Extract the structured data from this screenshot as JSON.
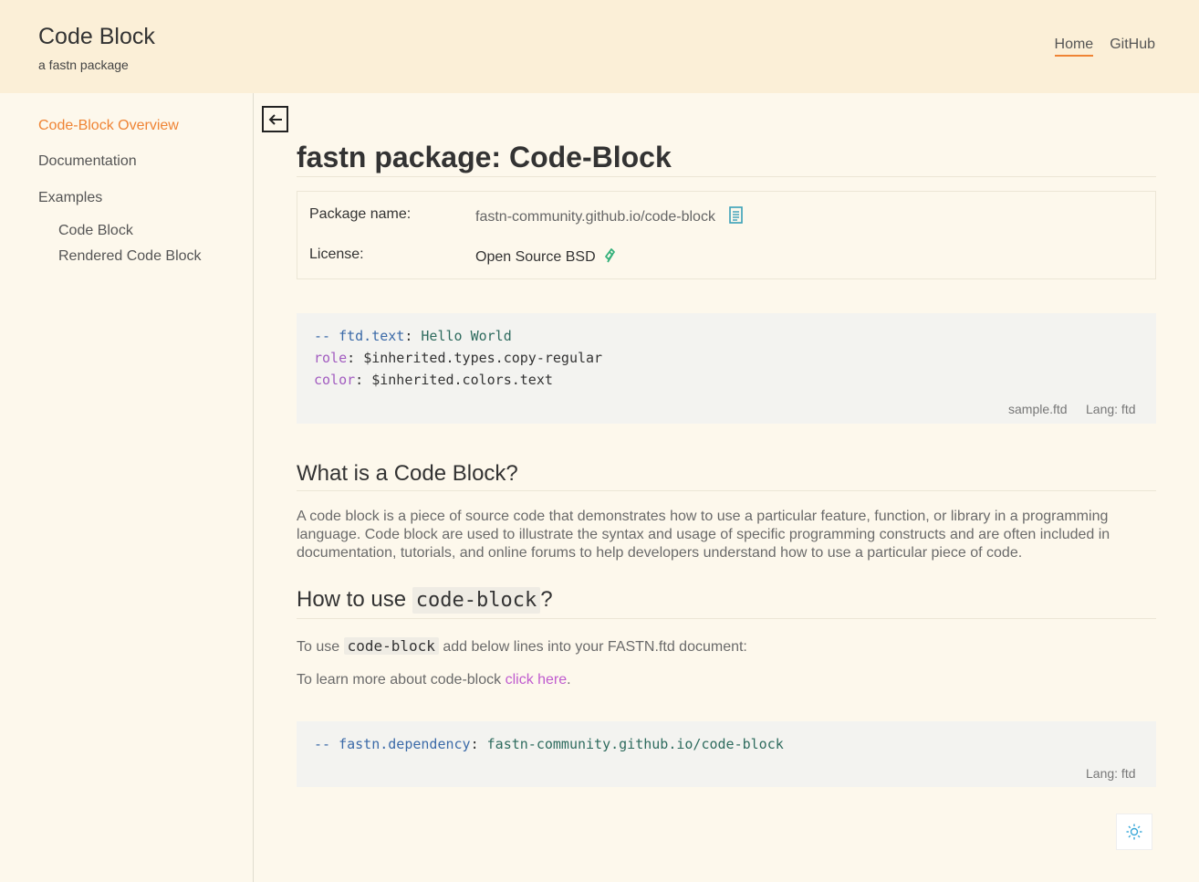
{
  "header": {
    "title": "Code Block",
    "subtitle": "a fastn package",
    "nav": [
      {
        "label": "Home",
        "active": true
      },
      {
        "label": "GitHub",
        "active": false
      }
    ]
  },
  "sidebar": {
    "items": [
      {
        "label": "Code-Block Overview",
        "active": true
      },
      {
        "label": "Documentation"
      },
      {
        "label": "Examples"
      }
    ],
    "subitems": [
      {
        "label": "Code Block"
      },
      {
        "label": "Rendered Code Block"
      }
    ]
  },
  "page": {
    "title": "fastn package: Code-Block",
    "info": {
      "package_label": "Package name:",
      "package_value": "fastn-community.github.io/code-block",
      "license_label": "License:",
      "license_value": "Open Source BSD"
    },
    "code1": {
      "line1_dash": "-- ",
      "line1_key": "ftd.text",
      "line1_colon": ": ",
      "line1_val": "Hello World",
      "line2_key": "role",
      "line2_colon": ": ",
      "line2_val": "$inherited.types.copy-regular",
      "line3_key": "color",
      "line3_colon": ": ",
      "line3_val": "$inherited.colors.text",
      "filename": "sample.ftd",
      "lang": "Lang: ftd"
    },
    "section1": {
      "heading": "What is a Code Block?",
      "text": "A code block is a piece of source code that demonstrates how to use a particular feature, function, or library in a programming language. Code block are used to illustrate the syntax and usage of specific programming constructs and are often included in documentation, tutorials, and online forums to help developers understand how to use a particular piece of code."
    },
    "section2": {
      "heading_pre": "How to use ",
      "heading_code": "code-block",
      "heading_post": "?",
      "usage_pre": "To use ",
      "usage_code": "code-block",
      "usage_post": " add below lines into your FASTN.ftd document:",
      "learn_pre": "To learn more about code-block ",
      "learn_link": "click here",
      "learn_post": "."
    },
    "code2": {
      "dash": "-- ",
      "key": "fastn.dependency",
      "colon": ": ",
      "val": "fastn-community.github.io/code-block",
      "lang": "Lang: ftd"
    }
  },
  "icons": {
    "back": "arrow-left-icon",
    "copy": "copy-icon",
    "link": "link-icon",
    "theme": "sun-icon"
  },
  "colors": {
    "accent": "#ef8435",
    "header_bg": "#fbefd7",
    "page_bg": "#fdf8ec",
    "link": "#c05ccf"
  }
}
